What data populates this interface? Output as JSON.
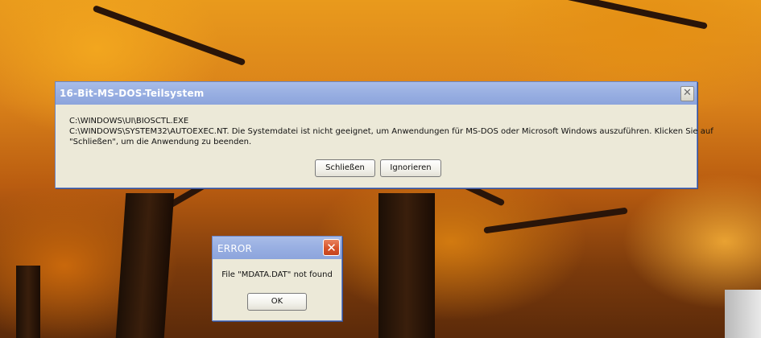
{
  "main_dialog": {
    "title": "16-Bit-MS-DOS-Teilsystem",
    "close_glyph": "✕",
    "message_lines": [
      "C:\\WINDOWS\\UI\\BIOSCTL.EXE",
      "C:\\WINDOWS\\SYSTEM32\\AUTOEXEC.NT. Die Systemdatei ist nicht geeignet, um Anwendungen für MS-DOS oder Microsoft Windows auszuführen. Klicken Sie auf",
      "\"Schließen\", um die Anwendung zu beenden."
    ],
    "buttons": {
      "close_label": "Schließen",
      "ignore_label": "Ignorieren"
    }
  },
  "error_dialog": {
    "title": "ERROR",
    "close_glyph": "✕",
    "message": "File \"MDATA.DAT\" not found",
    "ok_label": "OK"
  },
  "colors": {
    "titlebar": "#9bb1e3",
    "dialog_bg": "#ece9d8",
    "error_close": "#d7532a"
  }
}
